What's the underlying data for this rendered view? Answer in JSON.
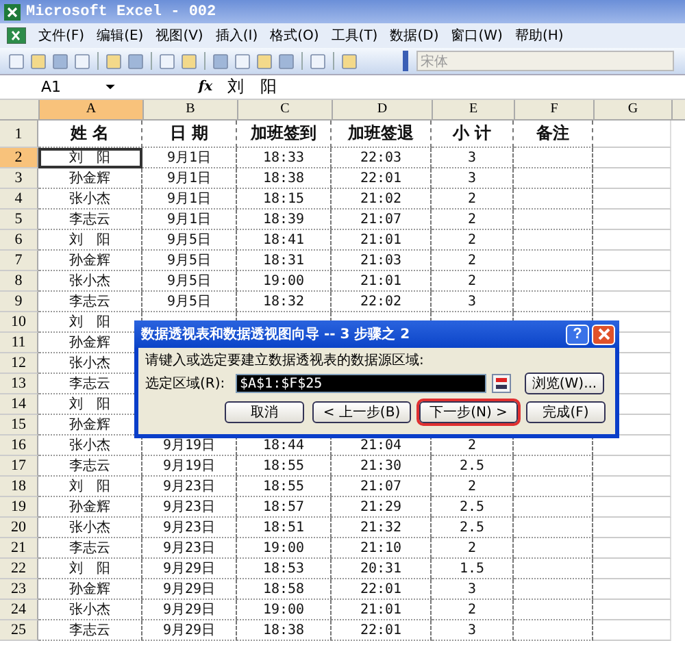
{
  "window": {
    "title": "Microsoft Excel - 002"
  },
  "menu": [
    "文件(F)",
    "编辑(E)",
    "视图(V)",
    "插入(I)",
    "格式(O)",
    "工具(T)",
    "数据(D)",
    "窗口(W)",
    "帮助(H)"
  ],
  "toolbar": {
    "font_box": {
      "value": "宋体",
      "disabled": true
    }
  },
  "formula_bar": {
    "name_box": "A1",
    "function_button": "fx",
    "formula": "刘　阳"
  },
  "sheet": {
    "columns": [
      {
        "label": "A",
        "selected": true
      },
      {
        "label": "B",
        "selected": false
      },
      {
        "label": "C",
        "selected": false
      },
      {
        "label": "D",
        "selected": false
      },
      {
        "label": "E",
        "selected": false
      },
      {
        "label": "F",
        "selected": false
      },
      {
        "label": "G",
        "selected": false
      }
    ],
    "rows": [
      {
        "number": "1",
        "kind": "header",
        "selected": false,
        "cells": [
          "姓 名",
          "日 期",
          "加班签到",
          "加班签退",
          "小 计",
          "备注"
        ]
      },
      {
        "number": "2",
        "kind": "data",
        "selected": true,
        "cells": [
          "刘　阳",
          "9月1日",
          "18:33",
          "22:03",
          "3"
        ]
      },
      {
        "number": "3",
        "kind": "data",
        "selected": false,
        "cells": [
          "孙金辉",
          "9月1日",
          "18:38",
          "22:01",
          "3"
        ]
      },
      {
        "number": "4",
        "kind": "data",
        "selected": false,
        "cells": [
          "张小杰",
          "9月1日",
          "18:15",
          "21:02",
          "2"
        ]
      },
      {
        "number": "5",
        "kind": "data",
        "selected": false,
        "cells": [
          "李志云",
          "9月1日",
          "18:39",
          "21:07",
          "2"
        ]
      },
      {
        "number": "6",
        "kind": "data",
        "selected": false,
        "cells": [
          "刘　阳",
          "9月5日",
          "18:41",
          "21:01",
          "2"
        ]
      },
      {
        "number": "7",
        "kind": "data",
        "selected": false,
        "cells": [
          "孙金辉",
          "9月5日",
          "18:31",
          "21:03",
          "2"
        ]
      },
      {
        "number": "8",
        "kind": "data",
        "selected": false,
        "cells": [
          "张小杰",
          "9月5日",
          "19:00",
          "21:01",
          "2"
        ]
      },
      {
        "number": "9",
        "kind": "data",
        "selected": false,
        "cells": [
          "李志云",
          "9月5日",
          "18:32",
          "22:02",
          "3"
        ]
      },
      {
        "number": "10",
        "kind": "data",
        "selected": false,
        "cells": [
          "刘　阳"
        ]
      },
      {
        "number": "11",
        "kind": "data",
        "selected": false,
        "cells": [
          "孙金辉"
        ]
      },
      {
        "number": "12",
        "kind": "data",
        "selected": false,
        "cells": [
          "张小杰"
        ]
      },
      {
        "number": "13",
        "kind": "data",
        "selected": false,
        "cells": [
          "李志云"
        ]
      },
      {
        "number": "14",
        "kind": "data",
        "selected": false,
        "cells": [
          "刘　阳"
        ]
      },
      {
        "number": "15",
        "kind": "data",
        "selected": false,
        "cells": [
          "孙金辉"
        ]
      },
      {
        "number": "16",
        "kind": "data",
        "selected": false,
        "cells": [
          "张小杰",
          "9月19日",
          "18:44",
          "21:04",
          "2"
        ]
      },
      {
        "number": "17",
        "kind": "data",
        "selected": false,
        "cells": [
          "李志云",
          "9月19日",
          "18:55",
          "21:30",
          "2.5"
        ]
      },
      {
        "number": "18",
        "kind": "data",
        "selected": false,
        "cells": [
          "刘　阳",
          "9月23日",
          "18:55",
          "21:07",
          "2"
        ]
      },
      {
        "number": "19",
        "kind": "data",
        "selected": false,
        "cells": [
          "孙金辉",
          "9月23日",
          "18:57",
          "21:29",
          "2.5"
        ]
      },
      {
        "number": "20",
        "kind": "data",
        "selected": false,
        "cells": [
          "张小杰",
          "9月23日",
          "18:51",
          "21:32",
          "2.5"
        ]
      },
      {
        "number": "21",
        "kind": "data",
        "selected": false,
        "cells": [
          "李志云",
          "9月23日",
          "19:00",
          "21:10",
          "2"
        ]
      },
      {
        "number": "22",
        "kind": "data",
        "selected": false,
        "cells": [
          "刘　阳",
          "9月29日",
          "18:53",
          "20:31",
          "1.5"
        ]
      },
      {
        "number": "23",
        "kind": "data",
        "selected": false,
        "cells": [
          "孙金辉",
          "9月29日",
          "18:58",
          "22:01",
          "3"
        ]
      },
      {
        "number": "24",
        "kind": "data",
        "selected": false,
        "cells": [
          "张小杰",
          "9月29日",
          "19:00",
          "21:01",
          "2"
        ]
      },
      {
        "number": "25",
        "kind": "data",
        "selected": false,
        "cells": [
          "李志云",
          "9月29日",
          "18:38",
          "22:01",
          "3"
        ]
      }
    ]
  },
  "dialog": {
    "title": "数据透视表和数据透视图向导 -- 3 步骤之 2",
    "help": "?",
    "prompt": "请键入或选定要建立数据透视表的数据源区域:",
    "range_label": "选定区域(R):",
    "range_value": "$A$1:$F$25",
    "browse": "浏览(W)...",
    "buttons": [
      {
        "label": "取消",
        "highlighted": false
      },
      {
        "label": "< 上一步(B)",
        "highlighted": false
      },
      {
        "label": "下一步(N) >",
        "highlighted": true
      },
      {
        "label": "完成(F)",
        "highlighted": false
      }
    ]
  }
}
